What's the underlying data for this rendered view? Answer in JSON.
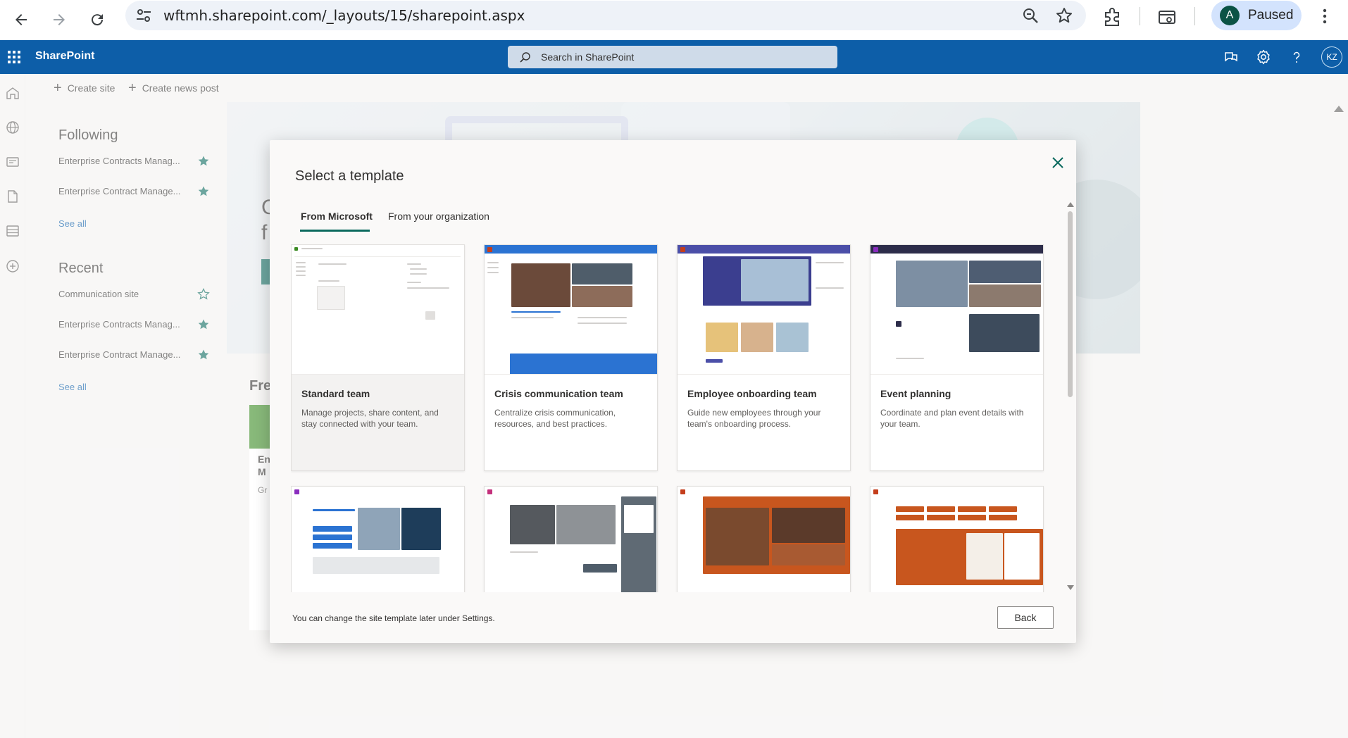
{
  "browser": {
    "url": "wftmh.sharepoint.com/_layouts/15/sharepoint.aspx",
    "profile_initial": "A",
    "profile_status": "Paused"
  },
  "suite": {
    "brand": "SharePoint",
    "search_placeholder": "Search in SharePoint",
    "user_initials": "KZ"
  },
  "commands": {
    "create_site": "Create site",
    "create_news_post": "Create news post"
  },
  "left_pane": {
    "following_heading": "Following",
    "following_items": [
      {
        "label": "Enterprise Contracts Manag...",
        "starred": true
      },
      {
        "label": "Enterprise Contract Manage...",
        "starred": true
      }
    ],
    "following_see_all": "See all",
    "recent_heading": "Recent",
    "recent_items": [
      {
        "label": "Communication site",
        "starred": false
      },
      {
        "label": "Enterprise Contracts Manag...",
        "starred": true
      },
      {
        "label": "Enterprise Contract Manage...",
        "starred": true
      }
    ],
    "recent_see_all": "See all"
  },
  "background": {
    "hero_partial_1": "C",
    "hero_partial_2": "f",
    "section_partial": "Fre",
    "card_partial_1": "En",
    "card_partial_2": "M",
    "card_partial_3": "Gr"
  },
  "dialog": {
    "title": "Select a template",
    "tabs": [
      {
        "label": "From Microsoft",
        "active": true
      },
      {
        "label": "From your organization",
        "active": false
      }
    ],
    "templates": [
      {
        "name": "Standard team",
        "description": "Manage projects, share content, and stay connected with your team.",
        "header_color": "#ffffff",
        "accent": "#3a8a22"
      },
      {
        "name": "Crisis communication team",
        "description": "Centralize crisis communication, resources, and best practices.",
        "header_color": "#2b73d2",
        "accent": "#c43e1c"
      },
      {
        "name": "Employee onboarding team",
        "description": "Guide new employees through your team's onboarding process.",
        "header_color": "#4b4fa8",
        "accent": "#c43e1c"
      },
      {
        "name": "Event planning",
        "description": "Coordinate and plan event details with your team.",
        "header_color": "#2d2d4a",
        "accent": "#8a2dbe"
      },
      {
        "name": "",
        "description": "",
        "header_color": "#ffffff",
        "accent": "#8a2dbe"
      },
      {
        "name": "",
        "description": "",
        "header_color": "#ffffff",
        "accent": "#c4317c"
      },
      {
        "name": "",
        "description": "",
        "header_color": "#ffffff",
        "accent": "#c43e1c"
      },
      {
        "name": "",
        "description": "",
        "header_color": "#ffffff",
        "accent": "#c43e1c"
      }
    ],
    "footer_note": "You can change the site template later under Settings.",
    "back_label": "Back"
  },
  "colors": {
    "suite_bar": "#0d5ea8",
    "accent_teal": "#0b6a5e",
    "star": "#0b6a5e"
  }
}
